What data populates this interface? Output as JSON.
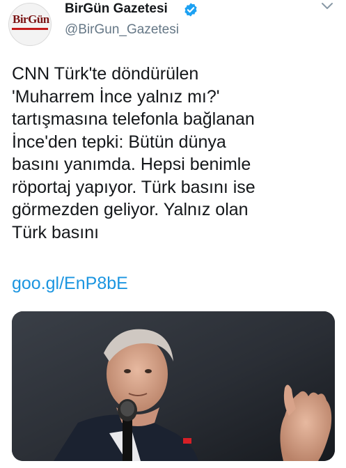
{
  "account": {
    "display_name": "BirGün Gazetesi",
    "handle": "@BirGun_Gazetesi",
    "avatar_logo_text": "BirGün",
    "verified_icon": "verified-badge-icon",
    "menu_icon": "chevron-down-icon"
  },
  "tweet": {
    "text": "CNN Türk'te döndürülen\n'Muharrem İnce yalnız mı?'\ntartışmasına telefonla bağlanan\nİnce'den tepki: Bütün dünya\nbasını yanımda. Hepsi benimle\nröportaj yapıyor. Türk basını ise\ngörmezden geliyor. Yalnız olan\nTürk basını",
    "link": "goo.gl/EnP8bE"
  },
  "colors": {
    "link": "#1b95e0",
    "verified": "#1da1f2",
    "secondary_text": "#657786"
  }
}
